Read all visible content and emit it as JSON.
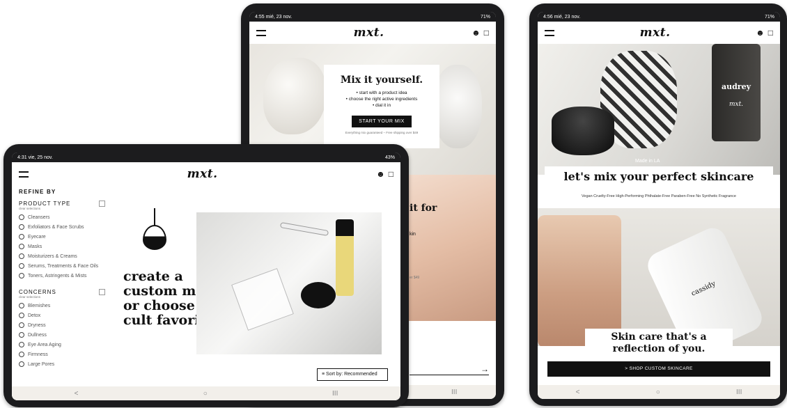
{
  "tablet_middle": {
    "status_time": "4:55 mié, 23 nov.",
    "status_right": "71%",
    "brand": "mxt.",
    "hero": {
      "title": "Mix it yourself.",
      "bullets": [
        "• start with a product idea",
        "• choose the right active ingredients",
        "• dial it in"
      ],
      "cta": "START YOUR MIX",
      "footnote": "Everything mix guaranteed – Free shipping over $49"
    },
    "second": {
      "title_fragment": "it for",
      "line_fragment": "kin",
      "foot_fragment": "er $49"
    },
    "arrow": "→"
  },
  "tablet_right": {
    "status_time": "4:56 mié, 23 nov.",
    "status_right": "71%",
    "brand": "mxt.",
    "made_in": "Made in LA",
    "headline": "let's mix your perfect skincare",
    "tags": "Vegan Cruelty-Free High-Performing Phthalate-Free Paraben-Free No Synthetic Fragrance",
    "bottle_label": "audrey",
    "bottle_brand": "mxt.",
    "bottle2_label": "cassidy",
    "tagline": "Skin care that's a reflection of you.",
    "cta": "> SHOP CUSTOM SKINCARE"
  },
  "tablet_left": {
    "status_time": "4:31 vie, 25 nov.",
    "status_right": "43%",
    "brand": "mxt.",
    "refine_by": "REFINE BY",
    "product_type": {
      "title": "PRODUCT TYPE",
      "clear": "clear selections",
      "items": [
        "Cleansers",
        "Exfoliators & Face Scrubs",
        "Eyecare",
        "Masks",
        "Moisturizers & Creams",
        "Serums, Treatments & Face Oils",
        "Toners, Astringents & Mists"
      ]
    },
    "concerns": {
      "title": "CONCERNS",
      "clear": "clear selections",
      "items": [
        "Blemishes",
        "Detox",
        "Dryness",
        "Dullness",
        "Eye Area Aging",
        "Firmness",
        "Large Pores"
      ]
    },
    "hero_text": "create a custom mix, or choose a cult favorite.",
    "sort": "Sort by: Recommended"
  },
  "sysnav": {
    "back": "<",
    "home": "○",
    "recents": "III"
  }
}
